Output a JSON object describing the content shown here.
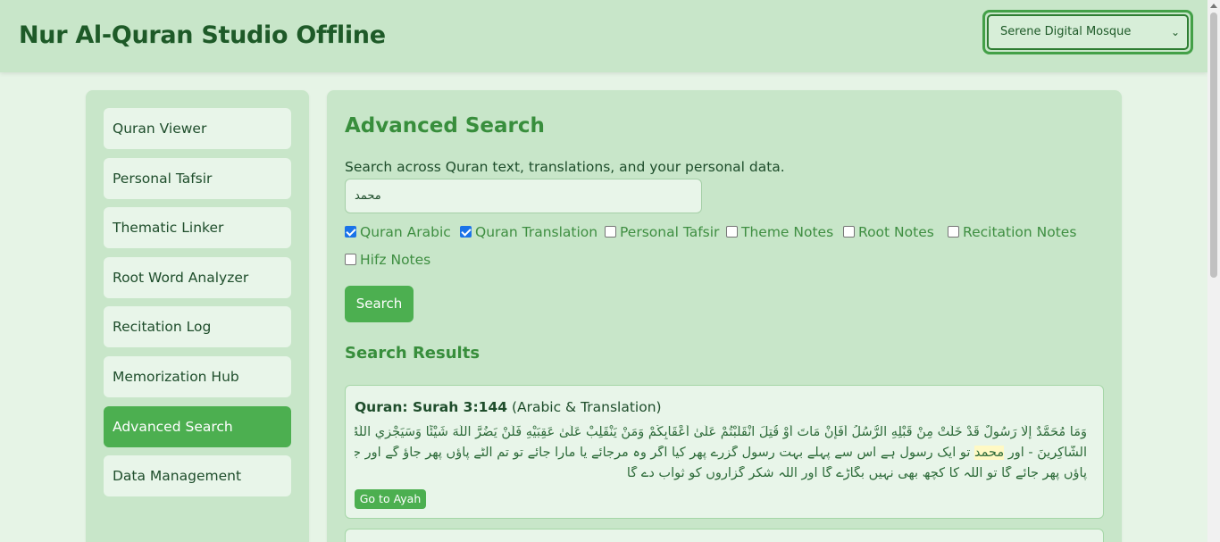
{
  "header": {
    "title": "Nur Al-Quran Studio Offline",
    "theme_select": {
      "selected": "Serene Digital Mosque"
    }
  },
  "sidebar": {
    "items": [
      {
        "label": "Quran Viewer",
        "active": false
      },
      {
        "label": "Personal Tafsir",
        "active": false
      },
      {
        "label": "Thematic Linker",
        "active": false
      },
      {
        "label": "Root Word Analyzer",
        "active": false
      },
      {
        "label": "Recitation Log",
        "active": false
      },
      {
        "label": "Memorization Hub",
        "active": false
      },
      {
        "label": "Advanced Search",
        "active": true
      },
      {
        "label": "Data Management",
        "active": false
      }
    ]
  },
  "main": {
    "title": "Advanced Search",
    "description": "Search across Quran text, translations, and your personal data.",
    "search_value": "محمد",
    "filters": [
      {
        "label": "Quran Arabic",
        "checked": true
      },
      {
        "label": "Quran Translation",
        "checked": true
      },
      {
        "label": "Personal Tafsir",
        "checked": false
      },
      {
        "label": "Theme Notes",
        "checked": false
      },
      {
        "label": "Root Notes",
        "checked": false
      },
      {
        "label": "Recitation Notes",
        "checked": false
      },
      {
        "label": "Hifz Notes",
        "checked": false
      }
    ],
    "search_button": "Search",
    "results_title": "Search Results",
    "results": [
      {
        "heading_bold": "Quran: Surah 3:144",
        "heading_rest": " (Arabic & Translation)",
        "arabic": "وَمَا مُحَمَّدٌ إِلَّا رَسُولٌ قَدْ خَلَتْ مِنْ قَبْلِهِ الرُّسُلُ أَفَإِنْ مَاتَ أَوْ قُتِلَ انْقَلَبْتُمْ عَلَىٰ أَعْقَابِكُمْ وَمَنْ يَنْقَلِبْ عَلَىٰ عَقِبَيْهِ فَلَنْ يَضُرَّ اللَّهَ شَيْئًا وَسَيَجْزِي اللَّهُ",
        "translation_pre": "الشَّاكِرِينَ - اور ",
        "translation_highlight": "محمد",
        "translation_post": " تو ایک رسول ہے اس سے پہلے بہت رسول گزرے پھر کیا اگر وہ مرجائے یا مارا جائے تو تم الٹے پاؤں پھر جاؤ گے اور جو کوئی الٹے",
        "translation_line3": "پاؤں پھر جائے گا تو اللہ کا کچھ بھی نہیں بگاڑے گا اور اللہ شکر گزاروں کو ثواب دے گا",
        "action": "Go to Ayah"
      }
    ]
  }
}
